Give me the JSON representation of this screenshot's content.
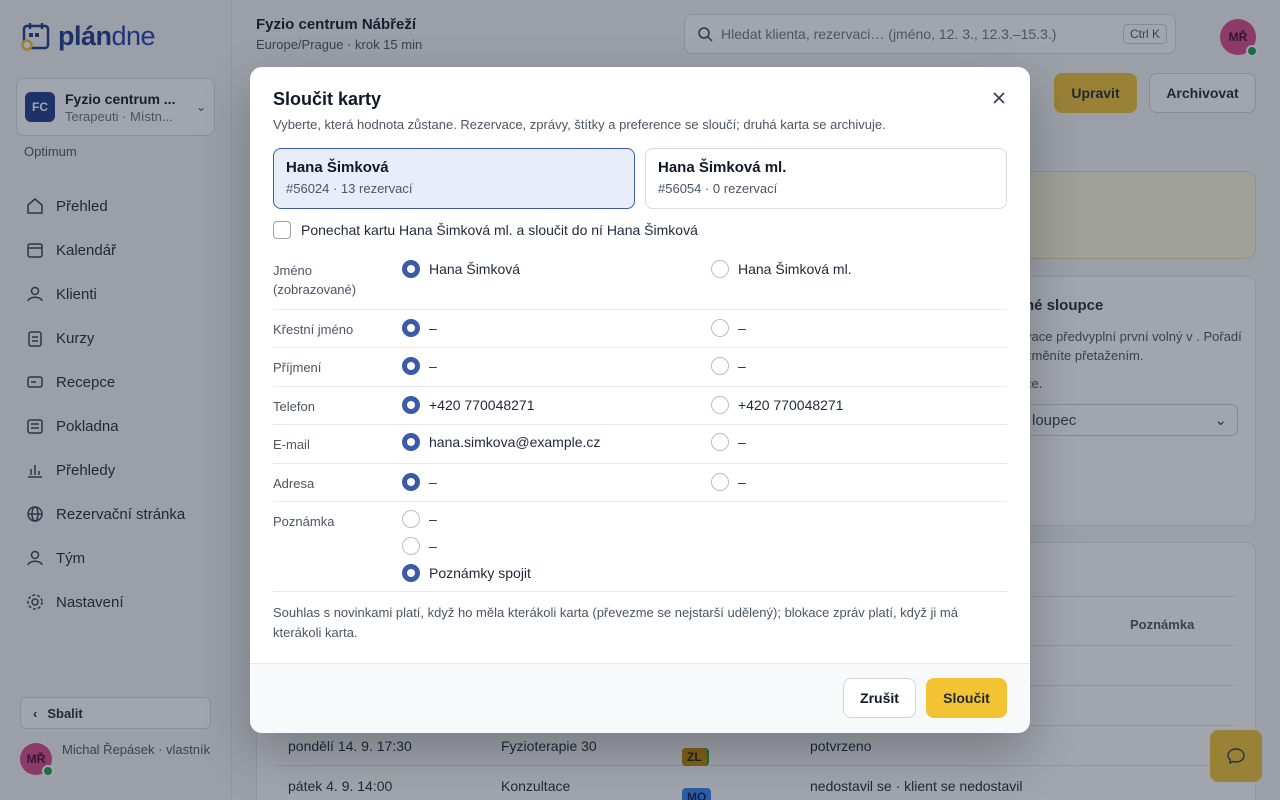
{
  "brand": {
    "logo_bold": "plán",
    "logo_light": "dne"
  },
  "org": {
    "badge": "FC",
    "name": "Fyzio centrum ...",
    "sub": "Terapeuti · Místn...",
    "plan": "Optimum"
  },
  "sidebar": {
    "items": [
      {
        "label": "Přehled",
        "icon": "home-icon"
      },
      {
        "label": "Kalendář",
        "icon": "calendar-icon"
      },
      {
        "label": "Klienti",
        "icon": "user-icon"
      },
      {
        "label": "Kurzy",
        "icon": "clipboard-icon"
      },
      {
        "label": "Recepce",
        "icon": "card-icon"
      },
      {
        "label": "Pokladna",
        "icon": "register-icon"
      },
      {
        "label": "Přehledy",
        "icon": "bar-chart-icon"
      },
      {
        "label": "Rezervační stránka",
        "icon": "globe-icon"
      },
      {
        "label": "Tým",
        "icon": "team-icon"
      },
      {
        "label": "Nastavení",
        "icon": "gear-icon"
      }
    ],
    "collapse_label": "Sbalit"
  },
  "user": {
    "initials": "MŘ",
    "name": "Michal Řepásek · vlastník"
  },
  "header": {
    "org_title": "Fyzio centrum Nábřeží",
    "timezone": "Europe/Prague · krok 15 min",
    "search_placeholder": "Hledat klienta, rezervaci… (jméno, 12. 3., 12.3.–15.3.)",
    "search_shortcut": "Ctrl K",
    "avatar_initials": "MŘ"
  },
  "page_actions": {
    "edit": "Upravit",
    "archive": "Archivovat"
  },
  "columns_card": {
    "title": "né sloupce",
    "text": "vace předvyplní první volný v . Pořadí změníte přetažením.",
    "text2": "ce.",
    "select": "loupec"
  },
  "table": {
    "note_header": "Poznámka",
    "rows": [
      {
        "date": "pondělí 14. 9. 17:30",
        "service": "Fyzioterapie 30",
        "tags": [
          "PH",
          "ZL"
        ],
        "status": "potvrzeno"
      },
      {
        "date": "pátek 4. 9. 14:00",
        "service": "Konzultace",
        "tags": [
          "PH",
          "MO"
        ],
        "status": "nedostavil se · klient se nedostavil"
      }
    ]
  },
  "modal": {
    "title": "Sloučit karty",
    "subtitle": "Vyberte, která hodnota zůstane. Rezervace, zprávy, štítky a preference se sloučí; druhá karta se archivuje.",
    "left_card": {
      "name": "Hana Šimková",
      "meta": "#56024 · 13 rezervací"
    },
    "right_card": {
      "name": "Hana Šimková ml.",
      "meta": "#56054 · 0 rezervací"
    },
    "keep_label": "Ponechat kartu Hana Šimková ml. a sloučit do ní Hana Šimková",
    "fields": [
      {
        "label": "Jméno (zobrazované)",
        "left": "Hana Šimková",
        "right": "Hana Šimková ml."
      },
      {
        "label": "Křestní jméno",
        "left": "–",
        "right": "–"
      },
      {
        "label": "Příjmení",
        "left": "–",
        "right": "–"
      },
      {
        "label": "Telefon",
        "left": "+420 770048271",
        "right": "+420 770048271"
      },
      {
        "label": "E-mail",
        "left": "hana.simkova@example.cz",
        "right": "–"
      },
      {
        "label": "Adresa",
        "left": "–",
        "right": "–"
      }
    ],
    "note_field": {
      "label": "Poznámka",
      "options": [
        "–",
        "–",
        "Poznámky spojit"
      ]
    },
    "footnote": "Souhlas s novinkami platí, když ho měla kterákoli karta (převezme se nejstarší udělený); blokace zpráv platí, když ji má kterákoli karta.",
    "cancel": "Zrušit",
    "merge": "Sloučit"
  },
  "colors": {
    "accent": "#f2c333",
    "primary": "#1e3a8a",
    "radio": "#3b5ba8"
  }
}
